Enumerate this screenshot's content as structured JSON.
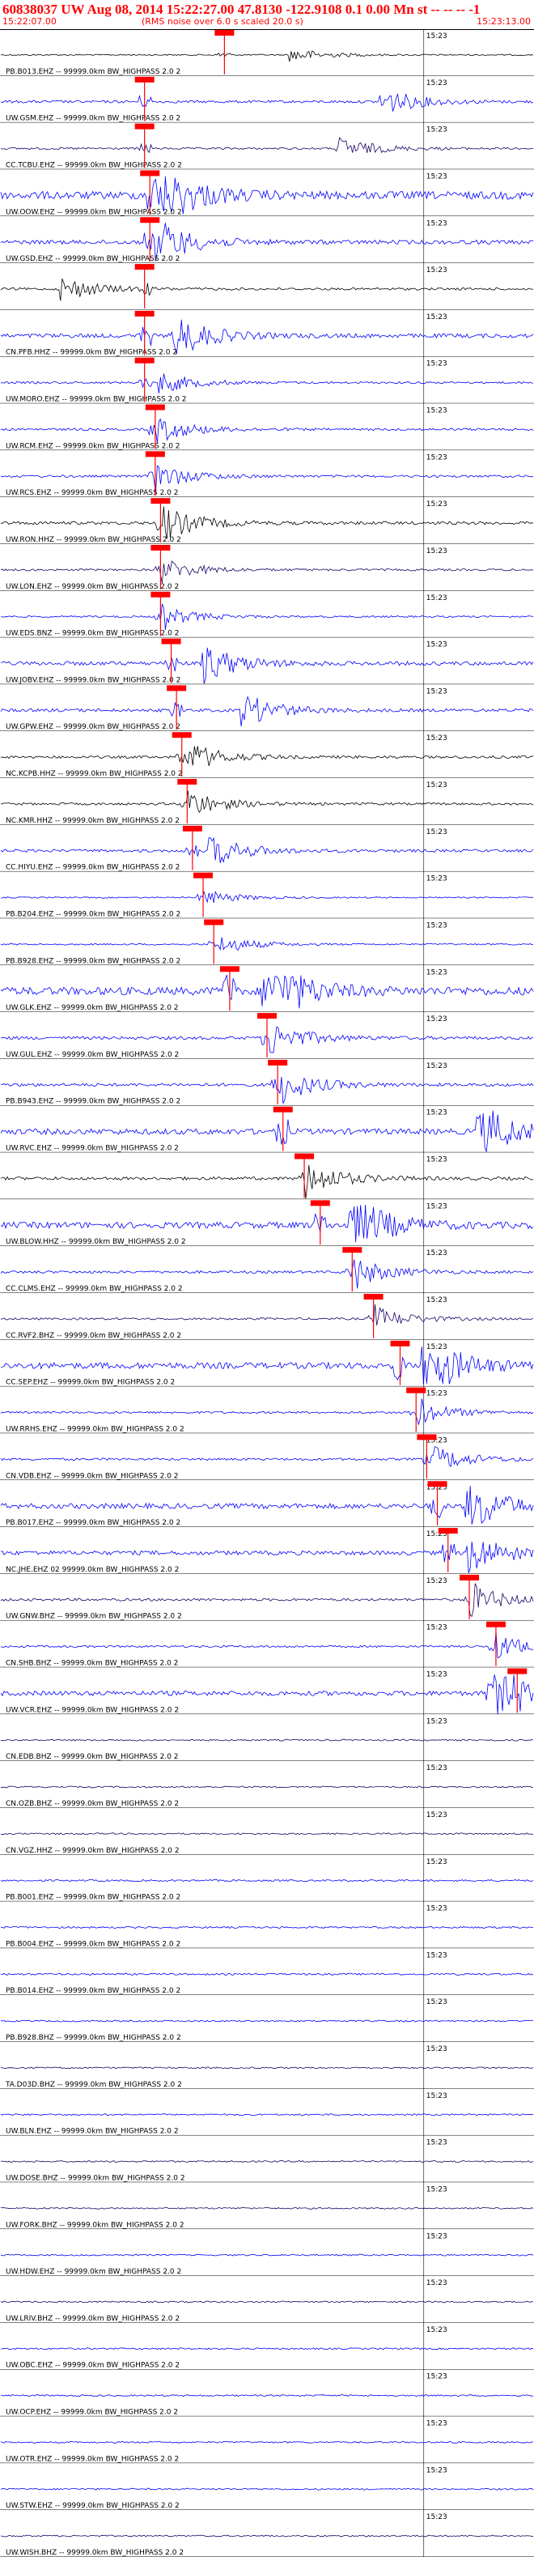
{
  "header": {
    "title": "60838037 UW Aug 08, 2014 15:22:27.00   47.8130 -122.9108  0.1 0.00 Mn st -- -- -- -1",
    "start_time": "15:22:07.00",
    "rms_note": "(RMS noise over 6.0 s scaled 20.0 s)",
    "end_time": "15:23:13.00"
  },
  "colors": {
    "blue": "#0000ff",
    "black": "#000000",
    "navy": "#1a0066",
    "pick": "#ff0000",
    "text": "#ff0000"
  },
  "chart_data": {
    "type": "line",
    "title": "",
    "x_start": "15:22:07.00",
    "x_end": "15:23:13.00",
    "minute_tick_label": "15:23",
    "series": [
      {
        "label": "PB.B013.EHZ -- 99999.0km BW_HIGHPASS 2.0 2",
        "color": "black",
        "pick": 0.42,
        "burst": 0.55,
        "amp": 0.5
      },
      {
        "label": "UW.GSM.EHZ -- 99999.0km BW_HIGHPASS 2.0 2",
        "color": "blue",
        "pick": 0.27,
        "burst": 0.72,
        "amp": 1.0
      },
      {
        "label": "CC.TCBU.EHZ -- 99999.0km BW_HIGHPASS 2.0 2",
        "color": "navy",
        "pick": 0.27,
        "burst": 0.64,
        "amp": 0.8
      },
      {
        "label": "UW.OOW.EHZ -- 99999.0km BW_HIGHPASS 2.0 2",
        "color": "blue",
        "pick": 0.28,
        "burst": 0.29,
        "amp": 3.0
      },
      {
        "label": "UW.GSD.EHZ -- 99999.0km BW_HIGHPASS 2.0 2",
        "color": "blue",
        "pick": 0.28,
        "burst": 0.3,
        "amp": 1.6
      },
      {
        "label": "",
        "color": "black",
        "pick": 0.27,
        "burst": 0.12,
        "amp": 0.9
      },
      {
        "label": "CN.PFB.HHZ -- 99999.0km BW_HIGHPASS 2.0 2",
        "color": "blue",
        "pick": 0.27,
        "burst": 0.33,
        "amp": 1.6
      },
      {
        "label": "UW.MORO.EHZ -- 99999.0km BW_HIGHPASS 2.0 2",
        "color": "blue",
        "pick": 0.27,
        "burst": 0.3,
        "amp": 0.8
      },
      {
        "label": "UW.RCM.EHZ -- 99999.0km BW_HIGHPASS 2.0 2",
        "color": "blue",
        "pick": 0.29,
        "burst": 0.3,
        "amp": 0.9
      },
      {
        "label": "UW.RCS.EHZ -- 99999.0km BW_HIGHPASS 2.0 2",
        "color": "blue",
        "pick": 0.29,
        "burst": 0.3,
        "amp": 0.9
      },
      {
        "label": "UW.RON.HHZ -- 99999.0km BW_HIGHPASS 2.0 2",
        "color": "black",
        "pick": 0.3,
        "burst": 0.31,
        "amp": 1.2
      },
      {
        "label": "UW.LON.EHZ -- 99999.0km BW_HIGHPASS 2.0 2",
        "color": "navy",
        "pick": 0.3,
        "burst": 0.31,
        "amp": 0.8
      },
      {
        "label": "UW.EDS.BNZ -- 99999.0km BW_HIGHPASS 2.0 2",
        "color": "blue",
        "pick": 0.3,
        "burst": 0.31,
        "amp": 0.7
      },
      {
        "label": "UW.JOBV.EHZ -- 99999.0km BW_HIGHPASS 2.0 2",
        "color": "blue",
        "pick": 0.32,
        "burst": 0.38,
        "amp": 1.5
      },
      {
        "label": "UW.GPW.EHZ -- 99999.0km BW_HIGHPASS 2.0 2",
        "color": "blue",
        "pick": 0.33,
        "burst": 0.46,
        "amp": 1.2
      },
      {
        "label": "NC.KCPB.HHZ -- 99999.0km BW_HIGHPASS 2.0 2",
        "color": "black",
        "pick": 0.34,
        "burst": 0.36,
        "amp": 1.0
      },
      {
        "label": "NC.KMR.HHZ -- 99999.0km BW_HIGHPASS 2.0 2",
        "color": "black",
        "pick": 0.35,
        "burst": 0.36,
        "amp": 0.9
      },
      {
        "label": "CC.HIYU.EHZ -- 99999.0km BW_HIGHPASS 2.0 2",
        "color": "blue",
        "pick": 0.36,
        "burst": 0.4,
        "amp": 1.1
      },
      {
        "label": "PB.B204.EHZ -- 99999.0km BW_HIGHPASS 2.0 2",
        "color": "blue",
        "pick": 0.38,
        "burst": 0.39,
        "amp": 0.5
      },
      {
        "label": "PB.B928.EHZ -- 99999.0km BW_HIGHPASS 2.0 2",
        "color": "blue",
        "pick": 0.4,
        "burst": 0.42,
        "amp": 0.6
      },
      {
        "label": "UW.GLK.EHZ -- 99999.0km BW_HIGHPASS 2.0 2",
        "color": "blue",
        "pick": 0.43,
        "burst": 0.5,
        "amp": 3.0
      },
      {
        "label": "UW.GUL.EHZ -- 99999.0km BW_HIGHPASS 2.0 2",
        "color": "blue",
        "pick": 0.5,
        "burst": 0.51,
        "amp": 1.2
      },
      {
        "label": "PB.B943.EHZ -- 99999.0km BW_HIGHPASS 2.0 2",
        "color": "blue",
        "pick": 0.52,
        "burst": 0.53,
        "amp": 1.2
      },
      {
        "label": "UW.RVC.EHZ -- 99999.0km BW_HIGHPASS 2.0 2",
        "color": "blue",
        "pick": 0.53,
        "burst": 0.9,
        "amp": 2.2
      },
      {
        "label": "",
        "color": "black",
        "pick": 0.57,
        "burst": 0.58,
        "amp": 1.2
      },
      {
        "label": "UW.BLOW.HHZ -- 99999.0km BW_HIGHPASS 2.0 2",
        "color": "blue",
        "pick": 0.6,
        "burst": 0.66,
        "amp": 2.4
      },
      {
        "label": "CC.CLMS.EHZ -- 99999.0km BW_HIGHPASS 2.0 2",
        "color": "blue",
        "pick": 0.66,
        "burst": 0.67,
        "amp": 1.0
      },
      {
        "label": "CC.RVF2.BHZ -- 99999.0km BW_HIGHPASS 2.0 2",
        "color": "navy",
        "pick": 0.7,
        "burst": 0.71,
        "amp": 0.8
      },
      {
        "label": "CC.SEP.EHZ -- 99999.0km BW_HIGHPASS 2.0 2",
        "color": "blue",
        "pick": 0.75,
        "burst": 0.8,
        "amp": 2.4
      },
      {
        "label": "UW.RRHS.EHZ -- 99999.0km BW_HIGHPASS 2.0 2",
        "color": "blue",
        "pick": 0.78,
        "burst": 0.79,
        "amp": 0.8
      },
      {
        "label": "CN.VDB.EHZ -- 99999.0km BW_HIGHPASS 2.0 2",
        "color": "blue",
        "pick": 0.8,
        "burst": 0.82,
        "amp": 0.9
      },
      {
        "label": "PB.B017.EHZ -- 99999.0km BW_HIGHPASS 2.0 2",
        "color": "blue",
        "pick": 0.82,
        "burst": 0.88,
        "amp": 2.0
      },
      {
        "label": "NC.JHE.EHZ 02 99999.0km BW_HIGHPASS 2.0 2",
        "color": "blue",
        "pick": 0.84,
        "burst": 0.88,
        "amp": 1.6
      },
      {
        "label": "UW.GNW.BHZ -- 99999.0km BW_HIGHPASS 2.0 2",
        "color": "navy",
        "pick": 0.88,
        "burst": 0.89,
        "amp": 1.0
      },
      {
        "label": "CN.SHB.BHZ -- 99999.0km BW_HIGHPASS 2.0 2",
        "color": "blue",
        "pick": 0.93,
        "burst": 0.94,
        "amp": 0.8
      },
      {
        "label": "UW.VCR.EHZ -- 99999.0km BW_HIGHPASS 2.0 2",
        "color": "blue",
        "pick": 0.97,
        "burst": 0.92,
        "amp": 1.8
      },
      {
        "label": "CN.EDB.BHZ -- 99999.0km BW_HIGHPASS 2.0 2",
        "color": "navy",
        "pick": null,
        "burst": null,
        "amp": 0.6
      },
      {
        "label": "CN.OZB.BHZ -- 99999.0km BW_HIGHPASS 2.0 2",
        "color": "navy",
        "pick": null,
        "burst": null,
        "amp": 0.6
      },
      {
        "label": "CN.VGZ.HHZ -- 99999.0km BW_HIGHPASS 2.0 2",
        "color": "navy",
        "pick": null,
        "burst": null,
        "amp": 0.6
      },
      {
        "label": "PB.B001.EHZ -- 99999.0km BW_HIGHPASS 2.0 2",
        "color": "blue",
        "pick": null,
        "burst": null,
        "amp": 0.7
      },
      {
        "label": "PB.B004.EHZ -- 99999.0km BW_HIGHPASS 2.0 2",
        "color": "blue",
        "pick": null,
        "burst": null,
        "amp": 0.7
      },
      {
        "label": "PB.B014.EHZ -- 99999.0km BW_HIGHPASS 2.0 2",
        "color": "blue",
        "pick": null,
        "burst": null,
        "amp": 0.7
      },
      {
        "label": "PB.B928.BHZ -- 99999.0km BW_HIGHPASS 2.0 2",
        "color": "blue",
        "pick": null,
        "burst": null,
        "amp": 0.6
      },
      {
        "label": "TA.D03D.BHZ -- 99999.0km BW_HIGHPASS 2.0 2",
        "color": "navy",
        "pick": null,
        "burst": null,
        "amp": 0.6
      },
      {
        "label": "UW.BLN.EHZ -- 99999.0km BW_HIGHPASS 2.0 2",
        "color": "blue",
        "pick": null,
        "burst": null,
        "amp": 0.6
      },
      {
        "label": "UW.DOSE.BHZ -- 99999.0km BW_HIGHPASS 2.0 2",
        "color": "navy",
        "pick": null,
        "burst": null,
        "amp": 0.6
      },
      {
        "label": "UW.FORK.BHZ -- 99999.0km BW_HIGHPASS 2.0 2",
        "color": "navy",
        "pick": null,
        "burst": null,
        "amp": 0.6
      },
      {
        "label": "UW.HDW.EHZ -- 99999.0km BW_HIGHPASS 2.0 2",
        "color": "blue",
        "pick": null,
        "burst": null,
        "amp": 0.6
      },
      {
        "label": "UW.LRIV.BHZ -- 99999.0km BW_HIGHPASS 2.0 2",
        "color": "navy",
        "pick": null,
        "burst": null,
        "amp": 0.6
      },
      {
        "label": "UW.OBC.EHZ -- 99999.0km BW_HIGHPASS 2.0 2",
        "color": "blue",
        "pick": null,
        "burst": null,
        "amp": 0.6
      },
      {
        "label": "UW.OCP.EHZ -- 99999.0km BW_HIGHPASS 2.0 2",
        "color": "blue",
        "pick": null,
        "burst": null,
        "amp": 0.6
      },
      {
        "label": "UW.OTR.EHZ -- 99999.0km BW_HIGHPASS 2.0 2",
        "color": "blue",
        "pick": null,
        "burst": null,
        "amp": 0.6
      },
      {
        "label": "UW.STW.EHZ -- 99999.0km BW_HIGHPASS 2.0 2",
        "color": "blue",
        "pick": null,
        "burst": null,
        "amp": 0.6
      },
      {
        "label": "UW.WISH.BHZ -- 99999.0km BW_HIGHPASS 2.0 2",
        "color": "navy",
        "pick": null,
        "burst": null,
        "amp": 0.6
      }
    ]
  }
}
